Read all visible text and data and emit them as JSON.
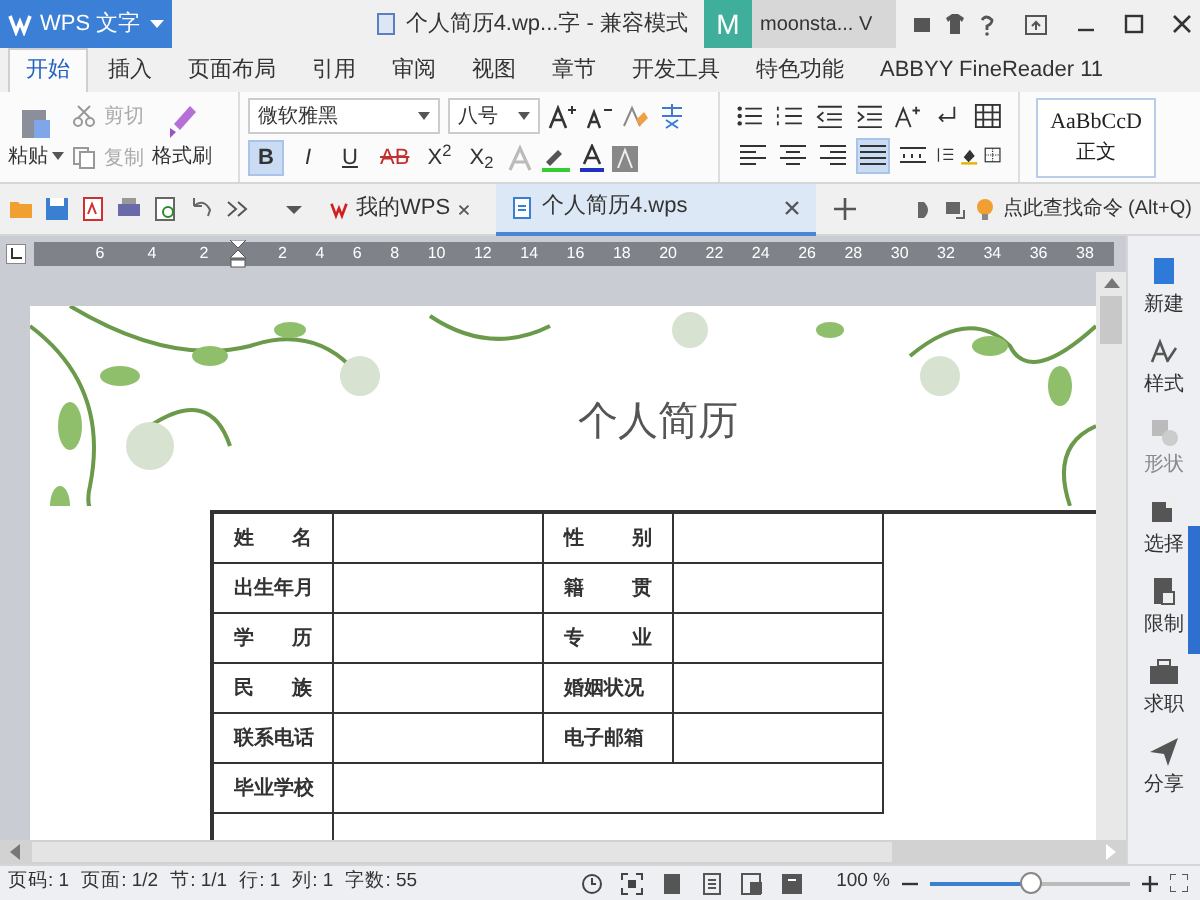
{
  "app_button": {
    "label": "WPS 文字"
  },
  "window": {
    "title": "个人简历4.wp...字 - 兼容模式"
  },
  "account": {
    "initial": "M",
    "name": "moonsta... V"
  },
  "ribbon_tabs": [
    {
      "label": "开始",
      "selected": true
    },
    {
      "label": "插入",
      "selected": false
    },
    {
      "label": "页面布局",
      "selected": false
    },
    {
      "label": "引用",
      "selected": false
    },
    {
      "label": "审阅",
      "selected": false
    },
    {
      "label": "视图",
      "selected": false
    },
    {
      "label": "章节",
      "selected": false
    },
    {
      "label": "开发工具",
      "selected": false
    },
    {
      "label": "特色功能",
      "selected": false
    },
    {
      "label": "ABBYY FineReader 11",
      "selected": false
    }
  ],
  "clipboard": {
    "paste": "粘贴",
    "cut": {
      "label": "剪切",
      "disabled": true
    },
    "copy": {
      "label": "复制",
      "disabled": true
    },
    "format_painter": "格式刷"
  },
  "font": {
    "family": "微软雅黑",
    "size": "八号"
  },
  "format_buttons": [
    {
      "label": "B",
      "selected": true
    },
    {
      "label": "I",
      "selected": false
    },
    {
      "label": "U",
      "selected": false
    },
    {
      "label": "AB",
      "selected": false
    },
    {
      "label": "X$^{2}$",
      "selected": false
    },
    {
      "label": "X$_{2}$",
      "selected": false
    }
  ],
  "alignment": [
    {
      "kind": "left",
      "selected": false
    },
    {
      "kind": "center",
      "selected": false
    },
    {
      "kind": "right",
      "selected": false
    },
    {
      "kind": "justify",
      "selected": true
    },
    {
      "kind": "distributed",
      "selected": false
    }
  ],
  "style_preview": {
    "sample": "AaBbCcD",
    "name": "正文"
  },
  "doc_tabs": [
    {
      "label": "我的WPS",
      "kind": "home",
      "selected": false
    },
    {
      "label": "个人简历4.wps",
      "kind": "document",
      "selected": true
    }
  ],
  "command_search": {
    "label": "点此查找命令 (Alt+Q)"
  },
  "ruler": {
    "left_numbers": [
      "6",
      "4",
      "2"
    ],
    "right_numbers": [
      "2",
      "4",
      "6",
      "8",
      "10",
      "12",
      "14",
      "16",
      "18",
      "20",
      "22",
      "24",
      "26",
      "28",
      "30",
      "32",
      "34",
      "36",
      "38"
    ]
  },
  "document": {
    "title": "个人简历",
    "rows": [
      {
        "label_1": "姓 名",
        "label_2": "性 别"
      },
      {
        "label_1": "出生年月",
        "label_2": "籍 贯"
      },
      {
        "label_1": "学 历",
        "label_2": "专 业"
      },
      {
        "label_1": "民 族",
        "label_2": "婚姻状况"
      },
      {
        "label_1": "联系电话",
        "label_2": "电子邮箱"
      },
      {
        "label_1": "毕业学校"
      }
    ]
  },
  "sidebar": [
    {
      "label": "新建",
      "disabled": false
    },
    {
      "label": "样式",
      "disabled": false
    },
    {
      "label": "形状",
      "disabled": true
    },
    {
      "label": "选择",
      "disabled": false
    },
    {
      "label": "限制",
      "disabled": false
    },
    {
      "label": "求职",
      "disabled": false
    },
    {
      "label": "分享",
      "disabled": false
    }
  ],
  "status_bar": {
    "items": [
      "页码: 1",
      "页面: 1/2",
      "节: 1/1",
      "行: 1",
      "列: 1",
      "字数: 55"
    ],
    "zoom": "100 %",
    "zoom_slider": {
      "level": 0.5
    }
  }
}
